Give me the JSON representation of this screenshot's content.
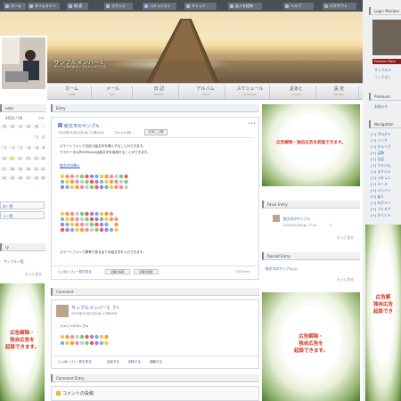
{
  "topnav": {
    "items": [
      "ホーム",
      "タイムライン",
      "検 索",
      "ラウンジ",
      "コミュニティ",
      "チャット",
      "友人を招待"
    ],
    "help": "ヘルプ",
    "logout": "ログアウト"
  },
  "profile": {
    "name": "サンプルメンバー1",
    "subtitle": "サークル365のサンプルメンバーです。"
  },
  "mainnav": [
    {
      "jp": "ホーム",
      "en": "HOME"
    },
    {
      "jp": "メール",
      "en": "MAIL"
    },
    {
      "jp": "日 記",
      "en": "ENTRIES"
    },
    {
      "jp": "アルバム",
      "en": "ALBUM"
    },
    {
      "jp": "スケジュール",
      "en": "SCHEDULE"
    },
    {
      "jp": "足あと",
      "en": "ACCESS"
    },
    {
      "jp": "設 定",
      "en": "SETTING"
    }
  ],
  "left": {
    "calendar_heading": "ndar",
    "calendar_month": "2022 / 04",
    "calendar_next": ">>",
    "weekdays": [
      "日",
      "月",
      "火",
      "水",
      "木"
    ],
    "days": [
      [
        "",
        "",
        "",
        "",
        ""
      ],
      [
        "3",
        "4",
        "5",
        "6",
        "7"
      ],
      [
        "10",
        "11",
        "12",
        "13",
        "14"
      ],
      [
        "17",
        "18",
        "19",
        "20",
        "21"
      ],
      [
        "24",
        "25",
        "26",
        "27",
        "28"
      ]
    ],
    "right_col": [
      "1",
      "8",
      "15",
      "22",
      "29"
    ],
    "right_col2": [
      "2",
      "9",
      "16",
      "23",
      "30"
    ],
    "category_items": [
      "の一覧",
      "ン一覧"
    ],
    "archive_heading": "ry",
    "archive_link": "サンプル一覧",
    "archive_more": "もっと見る",
    "ad_lines": [
      "広告解除・",
      "独自広告を",
      "起設できます。"
    ]
  },
  "entry": {
    "heading": "Entry",
    "title": "絵文字のサンプル",
    "date": "2022年01月20日(木) 17時42分",
    "comments": "コメント(8)",
    "badge": "全体に公開",
    "body1": "スマートフォンで日記で絵文字を挿入することができます。",
    "body2": "ウラケータ以外のiPhoneは絵文字を使用することができます。",
    "link": "絵文字の挿入",
    "body3": "スマートフォンで携帯で見る全ての絵文字を入力できます。",
    "likes": "いいね！(1) 一覧を見る",
    "edit": "記事の編集",
    "delete": "記事の削除",
    "views": "135 View"
  },
  "comment": {
    "heading": "Comment",
    "author": "サンプルメンバー1",
    "author_suffix": "さん",
    "date": "2022年01月20日(木) 17時43分",
    "text": "コメントのサンプル",
    "likes": "いいね！(1) 一覧を見る",
    "reply": "返信する",
    "delete": "削除する",
    "report": "通報する"
  },
  "comment_entry": {
    "heading": "Comment Entry",
    "label": "コメントの投稿"
  },
  "right": {
    "ad_lines": [
      "広告解除・独自広告を起設できます。"
    ],
    "favor_heading": "Favor Entry",
    "favor_title": "絵文字のサンプル",
    "favor_meta": "2022/01/20(木) 17:42",
    "favor_count": "2",
    "favor_more": "もっと見る",
    "recent_heading": "Recent Entry",
    "recent_item": "絵文字のサンプル(1)",
    "recent_more": "もっと見る",
    "ad2_lines": [
      "広告解除・",
      "独自広告を",
      "起設できます。"
    ]
  },
  "far_right": {
    "login_heading": "Login Member",
    "premium_label": "Premium Mem",
    "member_link": "サンプルメ",
    "member_sub": "リンクはこ",
    "premium_heading": "Premium",
    "premium_link": "お知らせ ",
    "nav_heading": "Navigation",
    "nav_items": [
      "[+] ブログト",
      "[+] リンク",
      "[+] グループ",
      "[+] 足跡",
      "[+] 日記",
      "[+] アルバム",
      "[+] スケジュ",
      "[+] コミュニ",
      "[+] メール",
      "[+] メンバー",
      "[+] 友人",
      "[+] ログイン",
      "[+] プレミア",
      "[+] ポイント"
    ],
    "ad_lines": [
      "広告解",
      "独自広告",
      "起設でき"
    ]
  },
  "colors": {
    "link": "#2a5db0",
    "ad_text": "#d2341d",
    "topbar": "#4a4f55"
  }
}
